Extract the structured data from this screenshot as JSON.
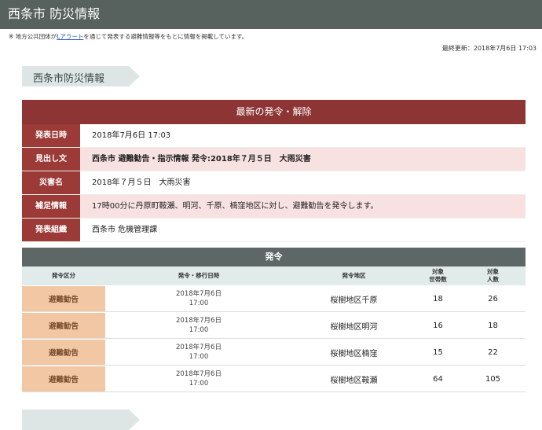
{
  "header": {
    "title": "西条市 防災情報"
  },
  "notice": {
    "prefix": "※ 地方公共団体が",
    "link": "Lアラート",
    "suffix": "を通じて発表する避難情報等をもとに情報を掲載しています。"
  },
  "last_updated": "最終更新：2018年7月6日 17:03",
  "section_title": "西条市防災情報",
  "latest": {
    "heading": "最新の発令・解除",
    "rows": [
      {
        "key": "発表日時",
        "value": "2018年7月6日 17:03"
      },
      {
        "key": "見出し文",
        "value": "西条市 避難勧告・指示情報 発令:2018年７月５日　大雨災害"
      },
      {
        "key": "災害名",
        "value": "2018年７月５日　大雨災害"
      },
      {
        "key": "補足情報",
        "value": "17時00分に丹原町鞍瀬、明河、千原、楠窪地区に対し、避難勧告を発令します。"
      },
      {
        "key": "発表組織",
        "value": "西条市 危機管理課"
      }
    ]
  },
  "issued": {
    "heading": "発令",
    "columns": {
      "kind": "発令区分",
      "datetime": "発令・移行日時",
      "area": "発令地区",
      "households_1": "対象",
      "households_2": "世帯数",
      "people_1": "対象",
      "people_2": "人数"
    },
    "rows": [
      {
        "kind": "避難勧告",
        "date": "2018年7月6日",
        "time": "17:00",
        "area": "桜樹地区千原",
        "households": "18",
        "people": "26"
      },
      {
        "kind": "避難勧告",
        "date": "2018年7月6日",
        "time": "17:00",
        "area": "桜樹地区明河",
        "households": "16",
        "people": "18"
      },
      {
        "kind": "避難勧告",
        "date": "2018年7月6日",
        "time": "17:00",
        "area": "桜樹地区楠窪",
        "households": "15",
        "people": "22"
      },
      {
        "kind": "避難勧告",
        "date": "2018年7月6日",
        "time": "17:00",
        "area": "桜樹地区鞍瀬",
        "households": "64",
        "people": "105"
      }
    ]
  },
  "colors": {
    "topbar": "#57615e",
    "latest_header": "#8d3534",
    "label_bg": "#9b3a37",
    "issued_header": "#5d6866",
    "kind_bg": "#f1c8a3"
  }
}
